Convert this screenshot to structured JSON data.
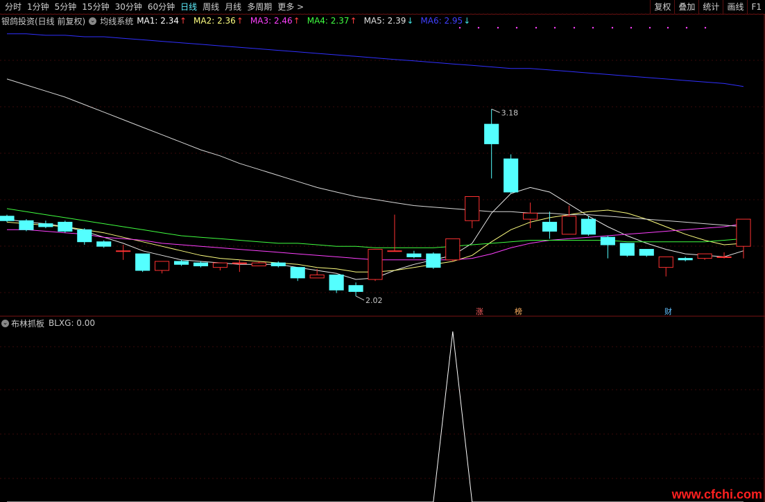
{
  "toolbar": {
    "periods": [
      "分时",
      "1分钟",
      "5分钟",
      "15分钟",
      "30分钟",
      "60分钟",
      "日线",
      "周线",
      "月线",
      "多周期",
      "更多 >"
    ],
    "active_index": 6,
    "right_buttons": [
      "复权",
      "叠加",
      "统计",
      "画线",
      "F1"
    ]
  },
  "legend": {
    "title": "银鸽投资(日线 前复权)",
    "system": "均线系统",
    "mas": [
      {
        "label": "MA1: 2.34",
        "color": "#ffffff",
        "dir": "up"
      },
      {
        "label": "MA2: 2.36",
        "color": "#ffff80",
        "dir": "up"
      },
      {
        "label": "MA3: 2.46",
        "color": "#ff40ff",
        "dir": "up"
      },
      {
        "label": "MA4: 2.37",
        "color": "#40ff40",
        "dir": "up"
      },
      {
        "label": "MA5: 2.39",
        "color": "#e0e0e0",
        "dir": "down"
      },
      {
        "label": "MA6: 2.95",
        "color": "#4040ff",
        "dir": "down"
      }
    ]
  },
  "indicator": {
    "name": "布林抓板",
    "value_label": "BLXG: 0.00"
  },
  "badges": [
    {
      "text": "涨",
      "color": "#ff6060"
    },
    {
      "text": "榜",
      "color": "#ffb060"
    },
    {
      "text": "财",
      "color": "#60c0ff"
    }
  ],
  "watermark": "www.cfchi.com",
  "chart_data": {
    "type": "candlestick",
    "high_label": "3.18",
    "low_label": "2.02",
    "candles": [
      {
        "o": 2.47,
        "c": 2.44,
        "h": 2.48,
        "l": 2.43
      },
      {
        "o": 2.44,
        "c": 2.38,
        "h": 2.45,
        "l": 2.37
      },
      {
        "o": 2.42,
        "c": 2.4,
        "h": 2.44,
        "l": 2.39
      },
      {
        "o": 2.43,
        "c": 2.37,
        "h": 2.44,
        "l": 2.36
      },
      {
        "o": 2.38,
        "c": 2.3,
        "h": 2.39,
        "l": 2.28
      },
      {
        "o": 2.3,
        "c": 2.27,
        "h": 2.31,
        "l": 2.26
      },
      {
        "o": 2.24,
        "c": 2.24,
        "h": 2.28,
        "l": 2.18
      },
      {
        "o": 2.22,
        "c": 2.11,
        "h": 2.22,
        "l": 2.1
      },
      {
        "o": 2.11,
        "c": 2.17,
        "h": 2.17,
        "l": 2.09
      },
      {
        "o": 2.17,
        "c": 2.15,
        "h": 2.18,
        "l": 2.14
      },
      {
        "o": 2.16,
        "c": 2.14,
        "h": 2.17,
        "l": 2.13
      },
      {
        "o": 2.13,
        "c": 2.16,
        "h": 2.16,
        "l": 2.11
      },
      {
        "o": 2.16,
        "c": 2.16,
        "h": 2.18,
        "l": 2.1
      },
      {
        "o": 2.14,
        "c": 2.16,
        "h": 2.17,
        "l": 2.14
      },
      {
        "o": 2.16,
        "c": 2.14,
        "h": 2.17,
        "l": 2.13
      },
      {
        "o": 2.13,
        "c": 2.06,
        "h": 2.13,
        "l": 2.04
      },
      {
        "o": 2.06,
        "c": 2.08,
        "h": 2.12,
        "l": 2.06
      },
      {
        "o": 2.08,
        "c": 1.98,
        "h": 2.08,
        "l": 1.96
      },
      {
        "o": 2.01,
        "c": 1.97,
        "h": 2.03,
        "l": 1.94
      },
      {
        "o": 2.05,
        "c": 2.25,
        "h": 2.25,
        "l": 2.04
      },
      {
        "o": 2.24,
        "c": 2.24,
        "h": 2.48,
        "l": 2.24
      },
      {
        "o": 2.22,
        "c": 2.2,
        "h": 2.24,
        "l": 2.19
      },
      {
        "o": 2.22,
        "c": 2.13,
        "h": 2.23,
        "l": 2.12
      },
      {
        "o": 2.18,
        "c": 2.32,
        "h": 2.32,
        "l": 2.17
      },
      {
        "o": 2.44,
        "c": 2.6,
        "h": 2.6,
        "l": 2.39
      },
      {
        "o": 3.08,
        "c": 2.95,
        "h": 3.18,
        "l": 2.72
      },
      {
        "o": 2.85,
        "c": 2.63,
        "h": 2.88,
        "l": 2.62
      },
      {
        "o": 2.45,
        "c": 2.49,
        "h": 2.56,
        "l": 2.39
      },
      {
        "o": 2.43,
        "c": 2.37,
        "h": 2.5,
        "l": 2.32
      },
      {
        "o": 2.35,
        "c": 2.47,
        "h": 2.54,
        "l": 2.35
      },
      {
        "o": 2.45,
        "c": 2.35,
        "h": 2.47,
        "l": 2.34
      },
      {
        "o": 2.33,
        "c": 2.28,
        "h": 2.34,
        "l": 2.19
      },
      {
        "o": 2.29,
        "c": 2.21,
        "h": 2.29,
        "l": 2.2
      },
      {
        "o": 2.25,
        "c": 2.21,
        "h": 2.25,
        "l": 2.2
      },
      {
        "o": 2.13,
        "c": 2.2,
        "h": 2.2,
        "l": 2.07
      },
      {
        "o": 2.19,
        "c": 2.18,
        "h": 2.2,
        "l": 2.17
      },
      {
        "o": 2.19,
        "c": 2.22,
        "h": 2.22,
        "l": 2.18
      },
      {
        "o": 2.2,
        "c": 2.2,
        "h": 2.23,
        "l": 2.19
      },
      {
        "o": 2.27,
        "c": 2.45,
        "h": 2.45,
        "l": 2.19
      }
    ],
    "ma_series": [
      {
        "name": "MA1",
        "color": "#e8e8e8",
        "values": [
          2.45,
          2.43,
          2.42,
          2.4,
          2.37,
          2.33,
          2.29,
          2.24,
          2.21,
          2.18,
          2.17,
          2.16,
          2.15,
          2.15,
          2.15,
          2.13,
          2.11,
          2.09,
          2.05,
          2.06,
          2.11,
          2.15,
          2.18,
          2.21,
          2.29,
          2.49,
          2.62,
          2.66,
          2.63,
          2.55,
          2.47,
          2.4,
          2.34,
          2.29,
          2.25,
          2.22,
          2.21,
          2.2,
          2.24
        ]
      },
      {
        "name": "MA2",
        "color": "#ffff80",
        "values": [
          2.43,
          2.42,
          2.41,
          2.4,
          2.38,
          2.36,
          2.33,
          2.3,
          2.27,
          2.24,
          2.21,
          2.19,
          2.18,
          2.17,
          2.16,
          2.15,
          2.13,
          2.12,
          2.1,
          2.1,
          2.11,
          2.13,
          2.15,
          2.17,
          2.21,
          2.3,
          2.38,
          2.43,
          2.46,
          2.48,
          2.5,
          2.51,
          2.49,
          2.45,
          2.4,
          2.35,
          2.31,
          2.28,
          2.29
        ]
      },
      {
        "name": "MA3",
        "color": "#ff40ff",
        "values": [
          2.38,
          2.38,
          2.37,
          2.36,
          2.35,
          2.33,
          2.32,
          2.31,
          2.29,
          2.28,
          2.27,
          2.26,
          2.25,
          2.24,
          2.23,
          2.22,
          2.21,
          2.2,
          2.19,
          2.18,
          2.18,
          2.18,
          2.18,
          2.18,
          2.19,
          2.22,
          2.26,
          2.29,
          2.31,
          2.32,
          2.33,
          2.34,
          2.35,
          2.36,
          2.37,
          2.38,
          2.39,
          2.4,
          2.42
        ]
      },
      {
        "name": "MA4",
        "color": "#40ff40",
        "values": [
          2.52,
          2.5,
          2.48,
          2.46,
          2.44,
          2.42,
          2.4,
          2.38,
          2.36,
          2.34,
          2.33,
          2.32,
          2.31,
          2.3,
          2.29,
          2.29,
          2.28,
          2.27,
          2.27,
          2.26,
          2.26,
          2.26,
          2.26,
          2.27,
          2.28,
          2.29,
          2.3,
          2.31,
          2.31,
          2.31,
          2.31,
          2.31,
          2.3,
          2.3,
          2.3,
          2.3,
          2.3,
          2.31,
          2.32
        ]
      },
      {
        "name": "MA5",
        "color": "#d8d8d8",
        "values": [
          3.38,
          3.34,
          3.3,
          3.26,
          3.21,
          3.16,
          3.11,
          3.06,
          3.01,
          2.96,
          2.91,
          2.87,
          2.82,
          2.78,
          2.74,
          2.7,
          2.66,
          2.63,
          2.6,
          2.58,
          2.56,
          2.54,
          2.53,
          2.52,
          2.51,
          2.5,
          2.5,
          2.49,
          2.49,
          2.48,
          2.48,
          2.47,
          2.46,
          2.45,
          2.44,
          2.43,
          2.42,
          2.41,
          2.4
        ]
      },
      {
        "name": "MA6",
        "color": "#3030ff",
        "values": [
          3.68,
          3.68,
          3.67,
          3.67,
          3.66,
          3.66,
          3.65,
          3.64,
          3.63,
          3.62,
          3.61,
          3.6,
          3.59,
          3.58,
          3.57,
          3.56,
          3.55,
          3.54,
          3.53,
          3.52,
          3.51,
          3.5,
          3.49,
          3.48,
          3.47,
          3.46,
          3.45,
          3.45,
          3.44,
          3.43,
          3.42,
          3.41,
          3.4,
          3.39,
          3.38,
          3.37,
          3.36,
          3.35,
          3.33
        ]
      }
    ],
    "indicator_values": [
      0,
      0,
      0,
      0,
      0,
      0,
      0,
      0,
      0,
      0,
      0,
      0,
      0,
      0,
      0,
      0,
      0,
      0,
      0,
      0,
      0,
      0,
      0,
      1,
      0,
      0,
      0,
      0,
      0,
      0,
      0,
      0,
      0,
      0,
      0,
      0,
      0,
      0,
      0
    ],
    "ylim": [
      1.88,
      3.72
    ]
  }
}
